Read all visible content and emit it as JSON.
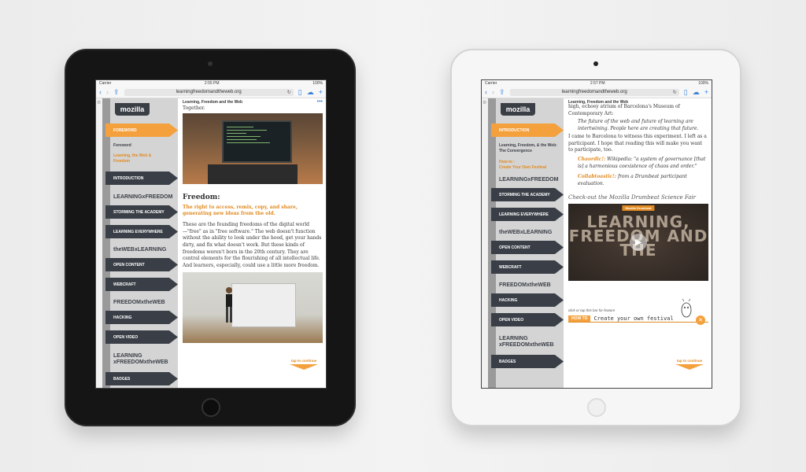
{
  "left": {
    "status": {
      "carrier": "Carrier",
      "time": "2:55 PM",
      "battery": "100%"
    },
    "url": "learningfreedomandtheweb.org",
    "crumb": "Learning, Freedom and the Web",
    "logo": "mozilla",
    "nav_active": "FOREWORD",
    "sub1": "Foreword",
    "sub2": "Learning, the Web & Freedom",
    "nav": [
      "INTRODUCTION",
      "STORMING THE ACADEMY",
      "LEARNING EVERYWHERE",
      "OPEN CONTENT",
      "WEBCRAFT",
      "HACKING",
      "OPEN VIDEO",
      "BADGES"
    ],
    "sections": [
      "LEARNINGxFREEDOM",
      "theWEBxLEARNING",
      "FREEDOMxtheWEB",
      "LEARNING xFREEDOMxtheWEB"
    ],
    "together": "Together.",
    "heading": "Freedom:",
    "lead": "The right to access, remix, copy, and share, generating new ideas from the old.",
    "paragraph": "These are the founding freedoms of the digital world—\"free\" as in \"free software.\" The web doesn't function without the ability to look under the hood, get your hands dirty, and fix what doesn't work. But these kinds of freedoms weren't born in the 20th century. They are central elements for the flourishing of all intellectual life. And learners, especially, could use a little more freedom.",
    "tap": "tap to continue"
  },
  "right": {
    "status": {
      "carrier": "Carrier",
      "time": "2:57 PM",
      "battery": "100%"
    },
    "url": "learningfreedomandtheweb.org",
    "crumb": "Learning, Freedom and the Web",
    "logo": "mozilla",
    "nav_active": "INTRODUCTION",
    "sub1": "Learning, Freedom, & the Web: The Convergence",
    "sub2a": "How-to :",
    "sub2b": "Create Your Own Festival",
    "nav": [
      "STORMING THE ACADEMY",
      "LEARNING EVERYWHERE",
      "OPEN CONTENT",
      "WEBCRAFT",
      "HACKING",
      "OPEN VIDEO",
      "BADGES"
    ],
    "sections": [
      "LEARNINGxFREEDOM",
      "theWEBxLEARNING",
      "FREEDOMxtheWEB",
      "LEARNING xFREEDOMxtheWEB"
    ],
    "p1": "high, echoey atrium of Barcelona's Museum of Contemporary Art:",
    "quote1": "The future of the web and future of learning are intertwining. People here are creating that future.",
    "p2": "I came to Barcelona to witness this experiment. I left as a participant. I hope that reading this will make you want to participate, too.",
    "chaordic": "Chaordic!:",
    "chaordic_text": "Wikipedia: \"a system of governance [that is] a harmonious coexistence of chaos and order.\"",
    "collab": "Collabtoastic!:",
    "collab_text": "from a Drumbeat participant evaluation.",
    "video_caption": "Check-out the Mozilla Drumbeat Science Fair",
    "video_tag": "Mozilla Drumbeat",
    "video_text": "LEARNING, FREEDOM AND THE",
    "click_hint": "click or tap this bar for feature",
    "howto_badge": "HOW TO",
    "howto_text": "Create your own festival",
    "tap": "tap to continue"
  }
}
